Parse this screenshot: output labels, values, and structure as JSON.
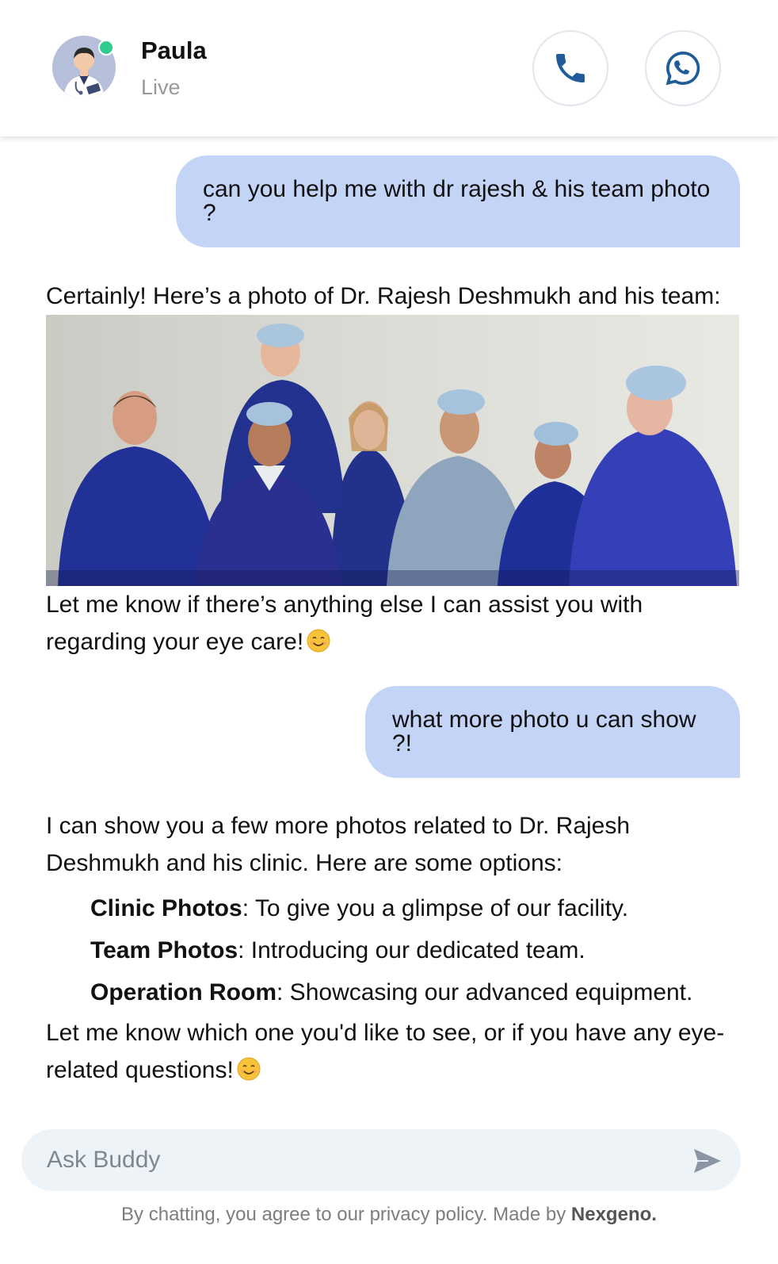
{
  "header": {
    "agent_name": "Paula",
    "status": "Live",
    "call_icon": "phone-icon",
    "chat_icon": "whatsapp-icon",
    "accent_color": "#1f5c99",
    "online_color": "#2ecc8f"
  },
  "messages": [
    {
      "role": "user",
      "text": "can you help me with dr rajesh & his team photo ?"
    },
    {
      "role": "bot",
      "intro": "Certainly! Here’s a photo of Dr. Rajesh Deshmukh and his team:",
      "outro": "Let me know if there’s anything else I can assist you with regarding your eye care!",
      "emoji": "smiling-face-icon"
    },
    {
      "role": "user",
      "text": "what more photo u can show ?!"
    },
    {
      "role": "bot",
      "intro": "I can show you a few more photos related to Dr. Rajesh Deshmukh and his clinic. Here are some options:",
      "options": [
        {
          "title": "Clinic Photos",
          "desc": ": To give you a glimpse of our facility."
        },
        {
          "title": "Team Photos",
          "desc": ": Introducing our dedicated team."
        },
        {
          "title": "Operation Room",
          "desc": ": Showcasing our advanced equipment."
        }
      ],
      "outro": "Let me know which one you'd like to see, or if you have any eye-related questions!",
      "emoji": "smiling-face-icon"
    }
  ],
  "composer": {
    "placeholder": "Ask Buddy",
    "value": "",
    "send_icon": "send-icon"
  },
  "footer": {
    "text": "By chatting, you agree to our privacy policy. Made by",
    "brand": "Nexgeno."
  },
  "colors": {
    "user_bubble": "#c3d4f7",
    "composer_bg": "#eef3f8"
  }
}
